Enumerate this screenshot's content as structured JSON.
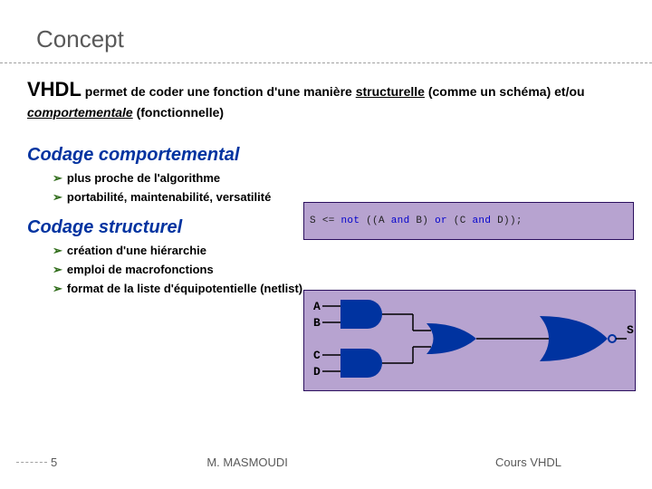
{
  "title": "Concept",
  "paragraph": {
    "kw": "VHDL",
    "pre": " permet de coder une fonction d'une manière ",
    "structurelle": "structurelle",
    "mid": " (comme un schéma) et/ou ",
    "comportementale": "comportementale",
    "post": " (fonctionnelle)"
  },
  "section1": {
    "head": "Codage comportemental",
    "items": [
      "plus proche de l'algorithme",
      "portabilité, maintenabilité, versatilité"
    ]
  },
  "section2": {
    "head": "Codage structurel",
    "items": [
      "création d'une hiérarchie",
      "emploi de macrofonctions",
      "format de la liste d'équipotentielle (netlist)"
    ]
  },
  "code": {
    "s": "S ",
    "assign": "<= ",
    "not_kw": "not",
    "p1": " ((A ",
    "and1": "and",
    "p2": " B) ",
    "or_kw": "or",
    "p3": " (C ",
    "and2": "and",
    "p4": " D));"
  },
  "diagram": {
    "labelA": "A",
    "labelB": "B",
    "labelC": "C",
    "labelD": "D",
    "labelS": "S"
  },
  "footer": {
    "page": "5",
    "center": "M. MASMOUDI",
    "right": "Cours VHDL"
  }
}
